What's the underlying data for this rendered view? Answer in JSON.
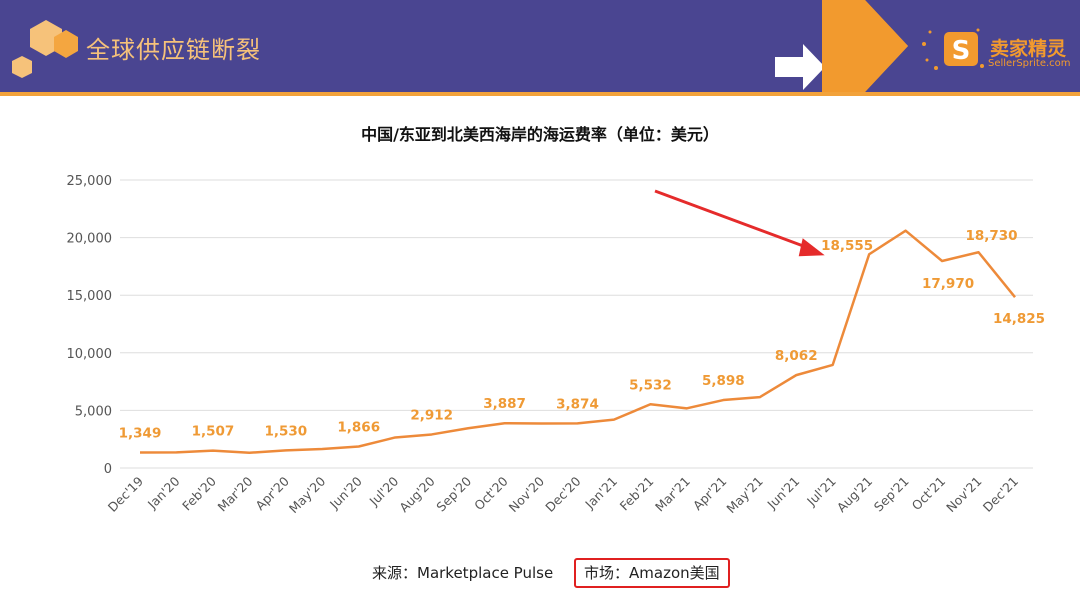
{
  "header": {
    "title": "全球供应链断裂",
    "logo_cn": "卖家精灵",
    "logo_en": "SellerSprite.com",
    "logo_icon": "s-logo-icon",
    "colors": {
      "banner": "#4a4591",
      "accent": "#f29a2e"
    }
  },
  "footer": {
    "source": "来源：Marketplace Pulse",
    "market": "市场：Amazon美国"
  },
  "chart_data": {
    "type": "line",
    "title": "中国/东亚到北美西海岸的海运费率（单位：美元）",
    "categories": [
      "Dec'19",
      "Jan'20",
      "Feb'20",
      "Mar'20",
      "Apr'20",
      "May'20",
      "Jun'20",
      "Jul'20",
      "Aug'20",
      "Sep'20",
      "Oct'20",
      "Nov'20",
      "Dec'20",
      "Jan'21",
      "Feb'21",
      "Mar'21",
      "Apr'21",
      "May'21",
      "Jun'21",
      "Jul'21",
      "Aug'21",
      "Sep'21",
      "Oct'21",
      "Nov'21",
      "Dec'21"
    ],
    "values": [
      1349,
      1360,
      1507,
      1320,
      1530,
      1650,
      1866,
      2650,
      2912,
      3450,
      3887,
      3860,
      3874,
      4200,
      5532,
      5180,
      5898,
      6150,
      8062,
      8950,
      18555,
      20600,
      17970,
      18730,
      14825
    ],
    "data_labels": [
      "1,349",
      "",
      "1,507",
      "",
      "1,530",
      "",
      "1,866",
      "",
      "2,912",
      "",
      "3,887",
      "",
      "3,874",
      "",
      "5,532",
      "",
      "5,898",
      "",
      "8,062",
      "",
      "18,555",
      "",
      "17,970",
      "18,730",
      "14,825"
    ],
    "yticks": [
      0,
      5000,
      10000,
      15000,
      20000,
      25000
    ],
    "ytick_labels": [
      "0",
      "5,000",
      "10,000",
      "15,000",
      "20,000",
      "25,000"
    ],
    "ylim": [
      0,
      25000
    ],
    "grid": true,
    "line_color": "#ed8a3a",
    "label_color": "#ef9a35",
    "annotation": {
      "type": "red-arrow",
      "target": "Aug'21",
      "color": "#e52b2b"
    }
  }
}
